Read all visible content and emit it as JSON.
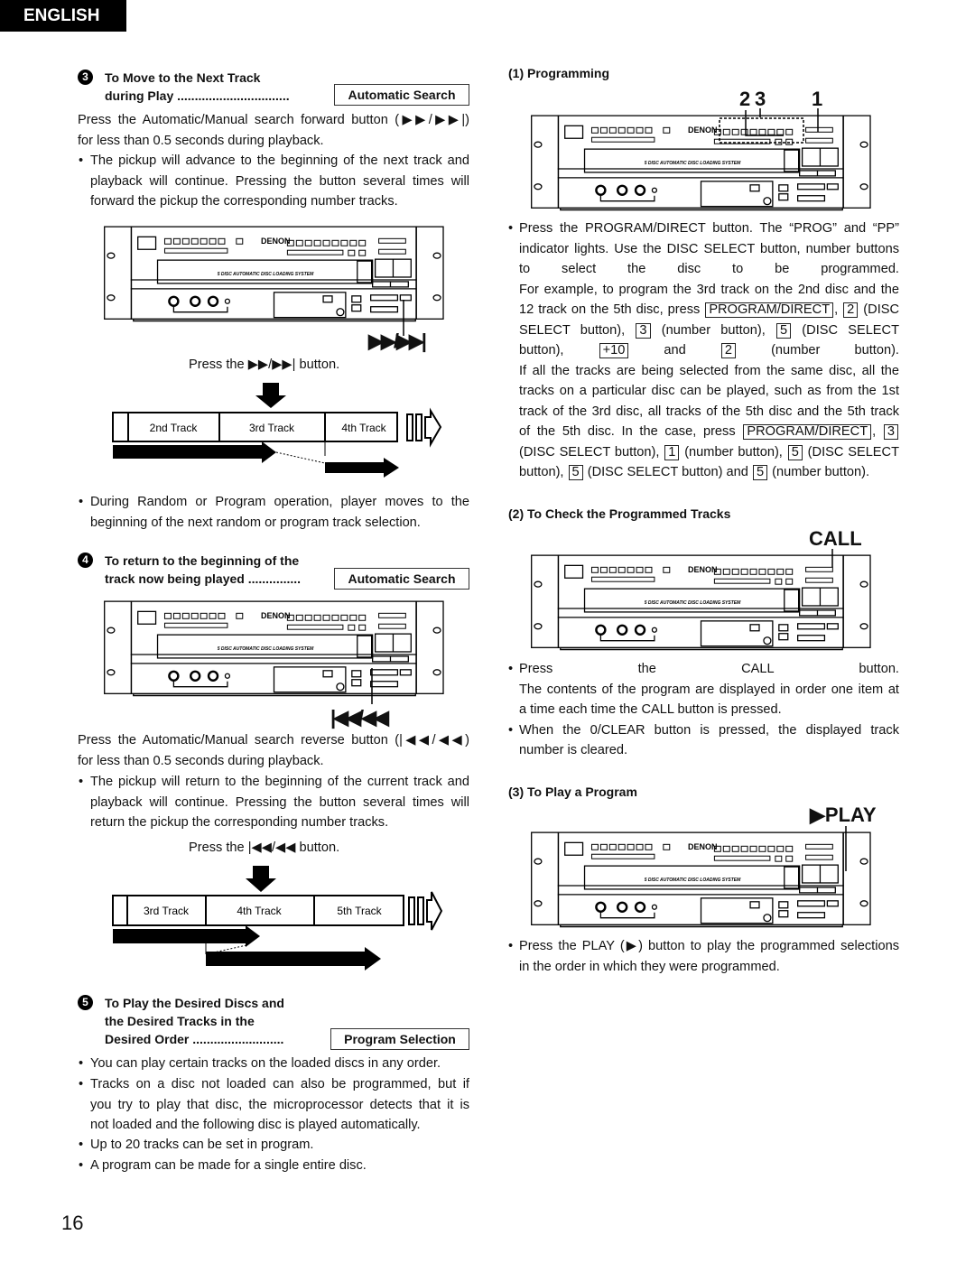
{
  "language_tab": "ENGLISH",
  "page_number": "16",
  "device": {
    "logo": "DENON",
    "tray_label": "5 DISC AUTOMATIC DISC LOADING SYSTEM"
  },
  "left": {
    "sec3": {
      "num": "3",
      "title1": "To Move to the Next Track",
      "title2": "during Play ................................",
      "mode": "Automatic Search",
      "para": [
        "Press the Automatic/Manual search forward button (▶▶/▶▶|)",
        "for less than 0.5 seconds during playback."
      ],
      "bullet": [
        "The pickup will advance to the beginning of the next track and",
        "playback will continue. Pressing the button several times will",
        "forward the pickup the corresponding number tracks."
      ],
      "callout": "▶▶/▶▶|",
      "press": "Press the ▶▶/▶▶| button.",
      "tracks": [
        "2nd Track",
        "3rd Track",
        "4th Track"
      ],
      "bullet2": [
        "During Random or Program operation, player moves to the",
        "beginning of the next random or program track selection."
      ]
    },
    "sec4": {
      "num": "4",
      "title1": "To return to the beginning of the",
      "title2": "track now being played ...............",
      "mode": "Automatic Search",
      "callout": "|◀◀/◀◀",
      "para": [
        "Press the Automatic/Manual search reverse button (|◀◀/◀◀)",
        "for less than 0.5 seconds during playback."
      ],
      "bullet": [
        "The pickup will return to the beginning of the current track and",
        "playback will continue. Pressing the button several times will",
        "return the pickup the corresponding number tracks."
      ],
      "press": "Press the |◀◀/◀◀ button.",
      "tracks": [
        "3rd Track",
        "4th Track",
        "5th Track"
      ]
    },
    "sec5": {
      "num": "5",
      "title1": "To Play the Desired Discs and",
      "title2": "the Desired Tracks in the",
      "title3": "Desired Order ..........................",
      "mode": "Program Selection",
      "bullets": [
        [
          "You can play certain tracks on the loaded discs in any order."
        ],
        [
          "Tracks on a disc not loaded can also be programmed, but if",
          "you try to play that disc, the microprocessor detects that it is",
          "not loaded and the following disc is played automatically."
        ],
        [
          "Up to 20 tracks can be set in program."
        ],
        [
          "A program can be made for a single entire disc."
        ]
      ]
    }
  },
  "right": {
    "prog": {
      "title": "(1)  Programming",
      "callouts": [
        "2",
        "3",
        "1"
      ],
      "lines": [
        [
          {
            "t": "Press the PROGRAM/DIRECT button. The “PROG” and “PP”"
          }
        ],
        [
          {
            "t": "indicator lights. Use the DISC SELECT button, number buttons"
          }
        ],
        [
          {
            "t": "to select the disc to be programmed."
          }
        ],
        [
          {
            "t": "For example, to program the 3rd track on the 2nd disc and the"
          }
        ],
        [
          {
            "t": "12 track on the 5th disc, press "
          },
          {
            "k": "PROGRAM/DIRECT"
          },
          {
            "t": ", "
          },
          {
            "k": "2"
          },
          {
            "t": " (DISC"
          }
        ],
        [
          {
            "t": "SELECT button), "
          },
          {
            "k": "3"
          },
          {
            "t": " (number button), "
          },
          {
            "k": "5"
          },
          {
            "t": " (DISC SELECT"
          }
        ],
        [
          {
            "t": "button), "
          },
          {
            "k": "+10"
          },
          {
            "t": " and "
          },
          {
            "k": "2"
          },
          {
            "t": " (number button)."
          }
        ],
        [
          {
            "t": "If all the tracks are being selected from the same disc, all the"
          }
        ],
        [
          {
            "t": "tracks on a particular disc can be played, such as from the 1st"
          }
        ],
        [
          {
            "t": "track of the 3rd disc, all tracks of the 5th disc and the 5th track"
          }
        ],
        [
          {
            "t": "of the 5th disc. In the case, press "
          },
          {
            "k": "PROGRAM/DIRECT"
          },
          {
            "t": ", "
          },
          {
            "k": "3"
          }
        ],
        [
          {
            "t": "(DISC SELECT button), "
          },
          {
            "k": "1"
          },
          {
            "t": " (number button), "
          },
          {
            "k": "5"
          },
          {
            "t": " (DISC SELECT"
          }
        ],
        [
          {
            "t": "button), "
          },
          {
            "k": "5"
          },
          {
            "t": " (DISC SELECT button) and "
          },
          {
            "k": "5"
          },
          {
            "t": " (number button)."
          }
        ]
      ]
    },
    "check": {
      "title": "(2)  To Check the Programmed Tracks",
      "callout": "CALL",
      "lines": [
        [
          {
            "t": "Press the CALL button."
          }
        ],
        [
          {
            "t": "The contents of the program are displayed in order one item at"
          }
        ],
        [
          {
            "t": "a time each time the CALL button is pressed."
          }
        ],
        [
          {
            "t": "When the 0/CLEAR button is pressed, the displayed track"
          }
        ],
        [
          {
            "t": "number is cleared."
          }
        ]
      ]
    },
    "play": {
      "title": "(3)  To Play a Program",
      "callout": "▶PLAY",
      "lines": [
        [
          {
            "t": "Press the PLAY (▶) button to play the programmed selections"
          }
        ],
        [
          {
            "t": "in the order in which they were programmed."
          }
        ]
      ]
    }
  }
}
